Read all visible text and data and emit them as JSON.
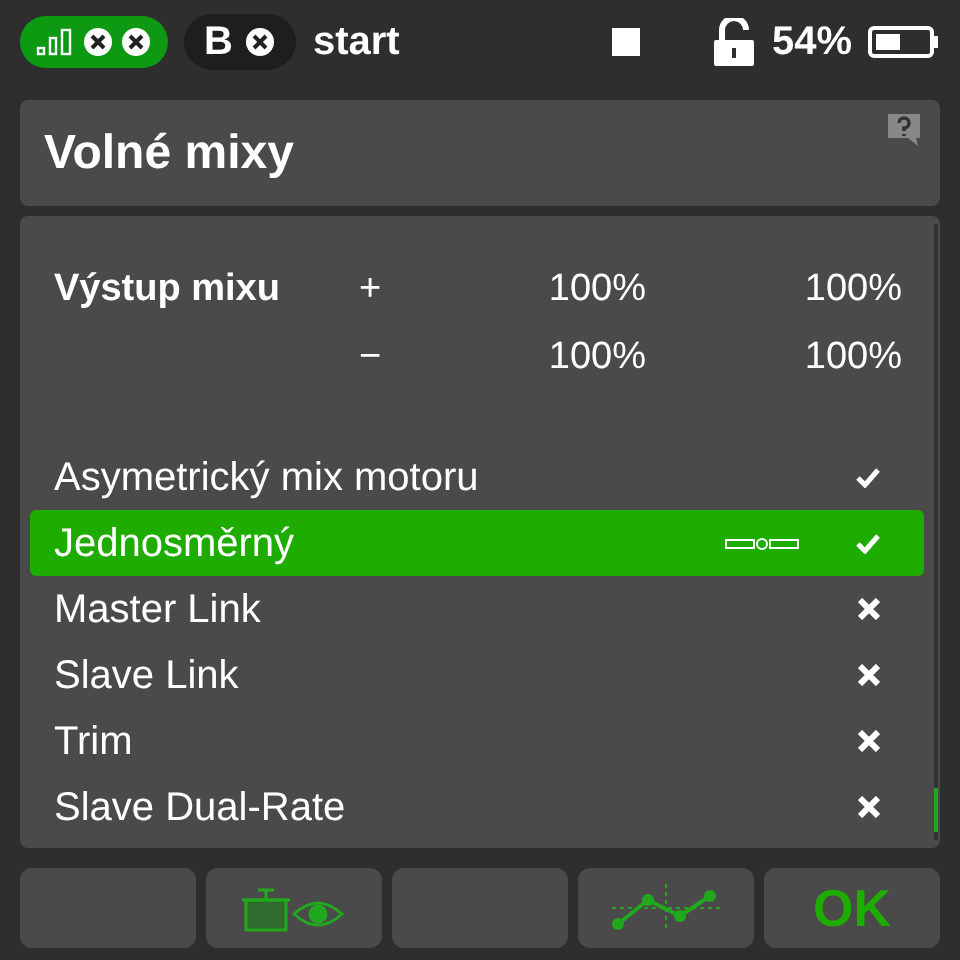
{
  "status_bar": {
    "receiver_label": "B",
    "flight_mode": "start",
    "battery": "54%"
  },
  "title": "Volné mixy",
  "output": {
    "label": "Výstup mixu",
    "rows": [
      {
        "sign": "+",
        "values": [
          "100%",
          "100%"
        ]
      },
      {
        "sign": "−",
        "values": [
          "100%",
          "100%"
        ]
      }
    ]
  },
  "mixes": [
    {
      "name": "Asymetrický mix motoru",
      "selected": false,
      "on": true,
      "curve_icon": false
    },
    {
      "name": "Jednosměrný",
      "selected": true,
      "on": true,
      "curve_icon": true
    },
    {
      "name": "Master Link",
      "selected": false,
      "on": false,
      "curve_icon": false
    },
    {
      "name": "Slave Link",
      "selected": false,
      "on": false,
      "curve_icon": false
    },
    {
      "name": "Trim",
      "selected": false,
      "on": false,
      "curve_icon": false
    },
    {
      "name": "Slave Dual-Rate",
      "selected": false,
      "on": false,
      "curve_icon": false
    }
  ],
  "buttons": [
    {
      "kind": "empty"
    },
    {
      "kind": "servo-view"
    },
    {
      "kind": "empty"
    },
    {
      "kind": "curve"
    },
    {
      "kind": "text",
      "label": "OK"
    }
  ]
}
